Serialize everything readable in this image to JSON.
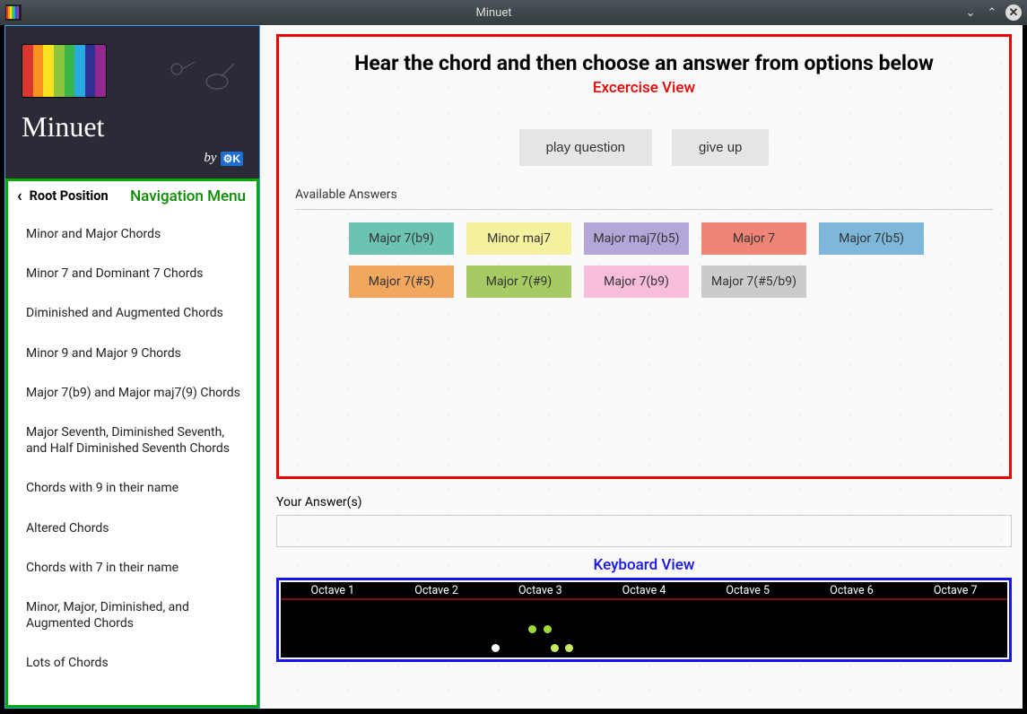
{
  "window": {
    "title": "Minuet"
  },
  "sidebar_header": {
    "app_name": "Minuet",
    "by_label": "by",
    "org_badge": "K"
  },
  "nav": {
    "back_icon": "‹",
    "title": "Root Position",
    "annotation": "Navigation Menu",
    "items": [
      "Minor and Major Chords",
      "Minor 7 and Dominant 7 Chords",
      "Diminished and Augmented Chords",
      "Minor 9 and Major 9 Chords",
      "Major 7(b9) and Major maj7(9) Chords",
      "Major Seventh, Diminished Seventh, and Half Diminished Seventh Chords",
      "Chords with 9 in their name",
      "Altered Chords",
      "Chords with 7 in their name",
      "Minor, Major, Diminished, and Augmented Chords",
      "Lots of Chords"
    ]
  },
  "exercise": {
    "annotation": "Excercise View",
    "prompt": "Hear the chord and then choose an answer from options below",
    "play_label": "play question",
    "giveup_label": "give up",
    "available_label": "Available Answers",
    "answers": [
      {
        "label": "Major 7(b9)",
        "color": "#6cc3b2"
      },
      {
        "label": "Minor maj7",
        "color": "#f4f29f"
      },
      {
        "label": "Major maj7(b5)",
        "color": "#b5a6d9"
      },
      {
        "label": "Major 7",
        "color": "#f08577"
      },
      {
        "label": "Major 7(b5)",
        "color": "#7db7da"
      },
      {
        "label": "Major 7(#5)",
        "color": "#f2a75e"
      },
      {
        "label": "Major 7(#9)",
        "color": "#a5cb62"
      },
      {
        "label": "Major 7(b9)",
        "color": "#f6bedb"
      },
      {
        "label": "Major 7(#5/b9)",
        "color": "#cbcbcb"
      }
    ],
    "your_answer_label": "Your Answer(s)"
  },
  "keyboard": {
    "annotation": "Keyboard View",
    "octaves": [
      "Octave 1",
      "Octave 2",
      "Octave 3",
      "Octave 4",
      "Octave 5",
      "Octave 6",
      "Octave 7"
    ],
    "highlights": [
      {
        "white_index": 14,
        "on_black_right": false,
        "color": "#fff"
      },
      {
        "white_index": 16,
        "on_black_right": true,
        "color": "#9edc39"
      },
      {
        "white_index": 17,
        "on_black_right": true,
        "color": "#9edc39"
      },
      {
        "white_index": 18,
        "on_black_right": false,
        "color": "#c9ec66"
      },
      {
        "white_index": 19,
        "on_black_right": false,
        "color": "#c9ec66"
      }
    ]
  },
  "rainbow_colors": [
    "#d93730",
    "#f7931e",
    "#f7e21e",
    "#8cc63f",
    "#39b54a",
    "#29abe2",
    "#2e3192",
    "#93278f"
  ]
}
